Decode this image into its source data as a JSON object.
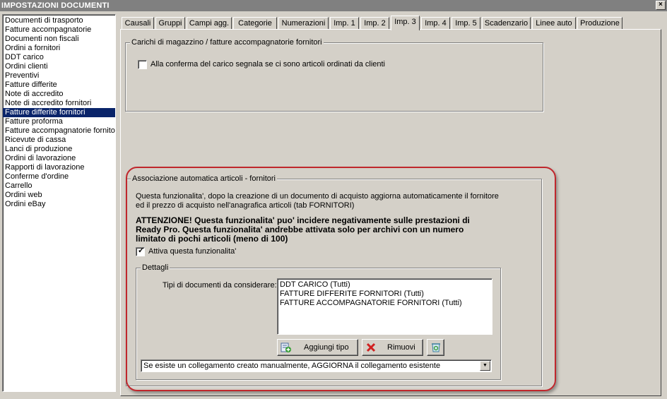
{
  "window": {
    "title": "IMPOSTAZIONI DOCUMENTI",
    "close_glyph": "×"
  },
  "documents": [
    "Documenti di trasporto",
    "Fatture accompagnatorie",
    "Documenti non fiscali",
    "Ordini a fornitori",
    "DDT carico",
    "Ordini clienti",
    "Preventivi",
    "Fatture differite",
    "Note di accredito",
    "Note di accredito fornitori",
    "Fatture differite fornitori",
    "Fatture proforma",
    "Fatture accompagnatorie fornitori",
    "Ricevute di cassa",
    "Lanci di produzione",
    "Ordini di lavorazione",
    "Rapporti di lavorazione",
    "Conferme d'ordine",
    "Carrello",
    "Ordini web",
    "Ordini eBay"
  ],
  "selected_document": "Fatture differite fornitori",
  "tabs": [
    "Causali",
    "Gruppi",
    "Campi agg.",
    "Categorie",
    "Numerazioni",
    "Imp. 1",
    "Imp. 2",
    "Imp. 3",
    "Imp. 4",
    "Imp. 5",
    "Scadenzario",
    "Linee auto",
    "Produzione"
  ],
  "active_tab": "Imp. 3",
  "carichi": {
    "title": "Carichi di magazzino / fatture accompagnatorie fornitori",
    "checkbox_label": "Alla conferma del carico segnala se ci sono articoli ordinati da clienti",
    "checked": false
  },
  "associazione": {
    "title": "Associazione automatica articoli - fornitori",
    "description_line1": "Questa funzionalita', dopo la creazione di un documento di acquisto aggiorna automaticamente il fornitore",
    "description_line2": "ed il prezzo di acquisto nell'anagrafica articoli (tab FORNITORI)",
    "warning_line1": "ATTENZIONE! Questa funzionalita' puo' incidere negativamente sulle prestazioni di",
    "warning_line2": "Ready Pro. Questa funzionalita' andrebbe attivata solo per archivi con un numero",
    "warning_line3": "limitato di pochi articoli (meno di 100)",
    "activate_label": "Attiva questa funzionalita'",
    "activate_checked": true,
    "checkmark_glyph": "✓",
    "dettagli": {
      "title": "Dettagli",
      "doc_types_label": "Tipi di documenti da considerare:",
      "doc_types": [
        "DDT CARICO (Tutti)",
        "FATTURE DIFFERITE FORNITORI (Tutti)",
        "FATTURE ACCOMPAGNATORIE FORNITORI (Tutti)"
      ],
      "add_button": "Aggiungi tipo",
      "remove_button": "Rimuovi"
    },
    "link_mode": "Se esiste un collegamento creato manualmente, AGGIORNA il collegamento esistente",
    "dropdown_glyph": "▼"
  },
  "colors": {
    "accent_selection": "#0a246a",
    "highlight_border": "#c0272d",
    "face": "#d4d0c8"
  }
}
